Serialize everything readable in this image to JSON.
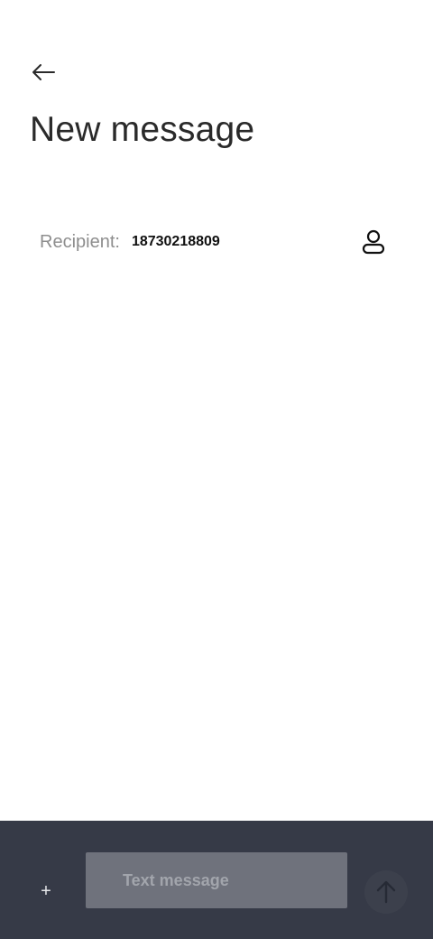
{
  "header": {
    "back_icon": "arrow-left-icon",
    "title": "New message"
  },
  "recipient": {
    "label": "Recipient:",
    "value": "18730218809",
    "contact_icon": "person-icon"
  },
  "composer": {
    "attach_icon": "plus-icon",
    "attach_glyph": "+",
    "placeholder": "Text message",
    "send_icon": "arrow-up-icon"
  },
  "colors": {
    "background": "#ffffff",
    "compose_bar": "#363a47",
    "input_background": "#6f727c",
    "send_button": "#3c404c",
    "label_gray": "#8e8e8e"
  }
}
